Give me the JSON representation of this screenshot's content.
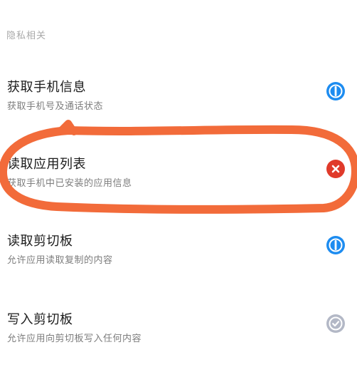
{
  "section": {
    "title": "隐私相关"
  },
  "items": [
    {
      "title": "获取手机信息",
      "description": "获取手机号及通话状态",
      "status": "allowed",
      "status_icon": "allow-icon",
      "status_color": "#1d8cf0"
    },
    {
      "title": "读取应用列表",
      "description": "获取手机中已安装的应用信息",
      "status": "denied",
      "status_icon": "deny-icon",
      "status_color": "#e03a2a"
    },
    {
      "title": "读取剪切板",
      "description": "允许应用读取复制的内容",
      "status": "allowed",
      "status_icon": "allow-icon",
      "status_color": "#1d8cf0"
    },
    {
      "title": "写入剪切板",
      "description": "允许应用向剪切板写入任何内容",
      "status": "granted",
      "status_icon": "check-icon",
      "status_color": "#b3b8c6"
    }
  ],
  "annotation": {
    "color": "#f26b3a"
  }
}
